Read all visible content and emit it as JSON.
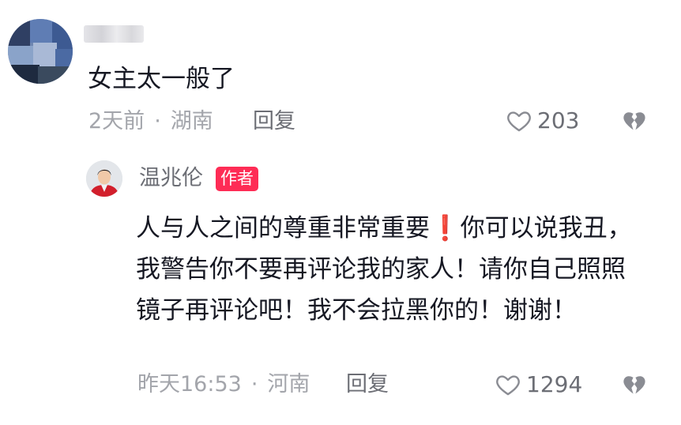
{
  "comment": {
    "text": "女主太一般了",
    "time": "2天前",
    "separator": "·",
    "location": "湖南",
    "reply_label": "回复",
    "likes": "203",
    "like_icon": "heart-outline-icon",
    "dislike_icon": "broken-heart-icon"
  },
  "reply": {
    "username": "温兆伦",
    "badge": "作者",
    "line1": "人与人之间的尊重非常重要",
    "emoji": "❗",
    "line1_rest": "你可以说我丑，我警告你不要再评论我的家人！请你自己照照镜子再评论吧！我不会拉黑你的！谢谢！",
    "time": "昨天16:53",
    "separator": "·",
    "location": "河南",
    "reply_label": "回复",
    "likes": "1294",
    "like_icon": "heart-outline-icon",
    "dislike_icon": "broken-heart-icon",
    "accent_color": "#fe2c55"
  }
}
